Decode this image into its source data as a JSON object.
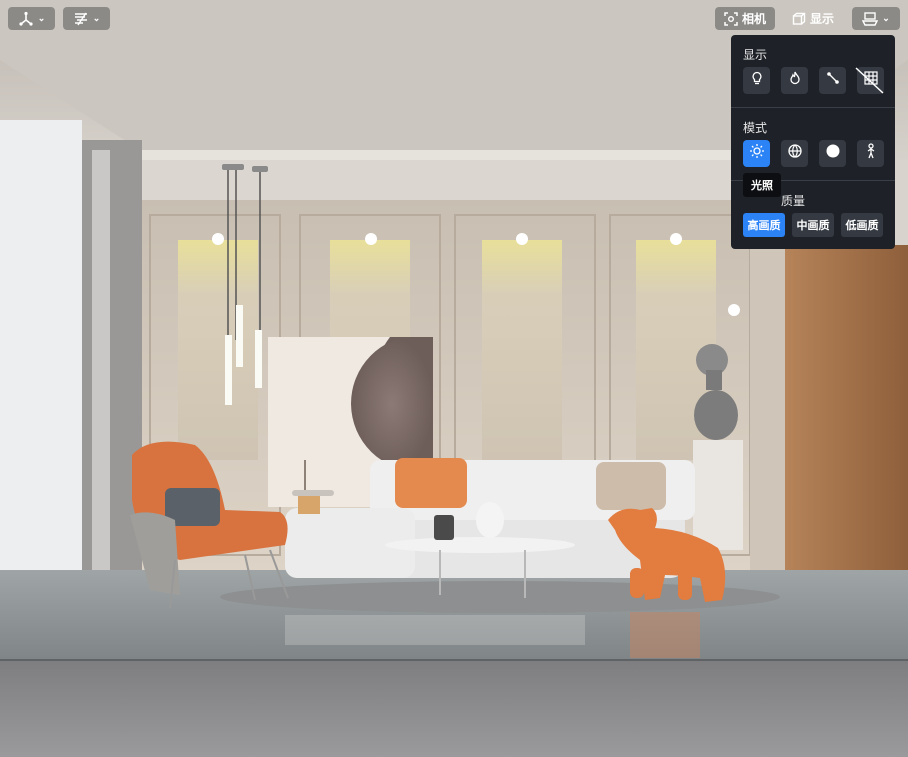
{
  "toolbar": {
    "left_buttons": [
      {
        "icon": "axis-gizmo-icon"
      },
      {
        "icon": "hatch-pattern-icon"
      }
    ],
    "camera_label": "相机",
    "display_label": "显示",
    "view_menu_icon": "floor-plan-icon"
  },
  "panel": {
    "display_title": "显示",
    "display_icons": [
      "lightbulb-icon",
      "flame-icon",
      "path-icon",
      "grid-icon"
    ],
    "mode_title": "模式",
    "mode_icons": [
      "sun-icon",
      "globe-icon",
      "circle-icon",
      "person-icon"
    ],
    "tooltip_text": "光照",
    "quality_title": "渲染质量",
    "quality_title_visible": "质量",
    "quality_options": [
      "高画质",
      "中画质",
      "低画质"
    ],
    "active_quality": "高画质"
  },
  "colors": {
    "accent": "#2b83f6",
    "panel_bg": "#1e2228",
    "sofa_orange": "#e08a4e"
  }
}
